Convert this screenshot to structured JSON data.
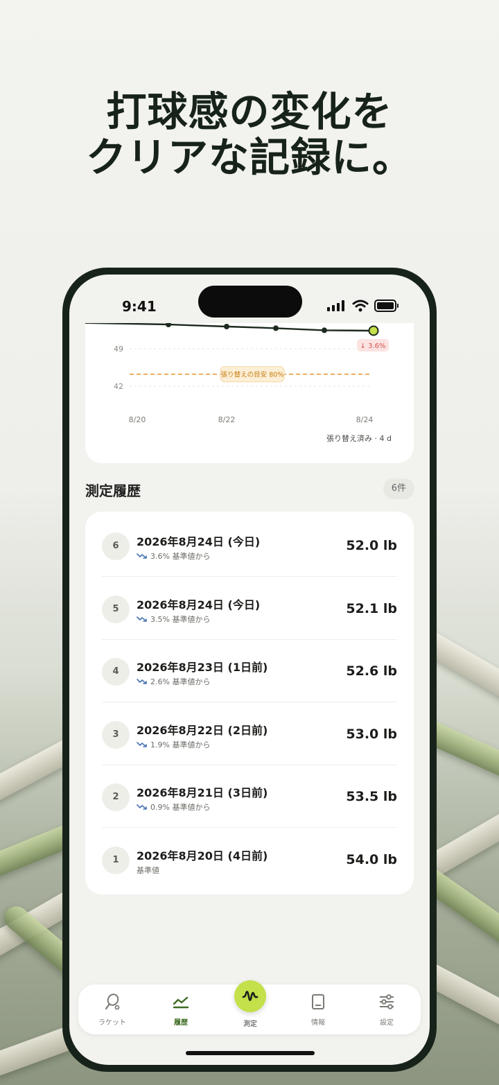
{
  "headline": {
    "line1": "打球感の変化を",
    "line2": "クリアな記録に。"
  },
  "status_bar": {
    "time": "9:41"
  },
  "chart_data": {
    "type": "line",
    "x": [
      "8/20",
      "8/21",
      "8/22",
      "8/23",
      "8/24",
      "8/24"
    ],
    "x_tick_labels": [
      "8/20",
      "8/22",
      "8/24"
    ],
    "y_tick_labels": [
      "49",
      "42"
    ],
    "series": [
      {
        "values": [
          54.0,
          53.5,
          53.0,
          52.6,
          52.1,
          52.0
        ]
      }
    ],
    "threshold": {
      "value": 43.2,
      "label": "張り替えの目安 80%"
    },
    "change_badge": "↓ 3.6%",
    "note": "張り替え済み · 4 d",
    "colors": {
      "line": "#1c2a1e",
      "threshold": "#e0962e",
      "current_point": "#c4e04a",
      "badge_text": "#d9534f"
    }
  },
  "history": {
    "title": "測定履歴",
    "count": "6件",
    "rows": [
      {
        "num": "6",
        "date": "2026年8月24日 (今日)",
        "sub": "3.6% 基準値から",
        "trend": true,
        "value": "52.0 lb"
      },
      {
        "num": "5",
        "date": "2026年8月24日 (今日)",
        "sub": "3.5% 基準値から",
        "trend": true,
        "value": "52.1 lb"
      },
      {
        "num": "4",
        "date": "2026年8月23日 (1日前)",
        "sub": "2.6% 基準値から",
        "trend": true,
        "value": "52.6 lb"
      },
      {
        "num": "3",
        "date": "2026年8月22日 (2日前)",
        "sub": "1.9% 基準値から",
        "trend": true,
        "value": "53.0 lb"
      },
      {
        "num": "2",
        "date": "2026年8月21日 (3日前)",
        "sub": "0.9% 基準値から",
        "trend": true,
        "value": "53.5 lb"
      },
      {
        "num": "1",
        "date": "2026年8月20日 (4日前)",
        "sub": "基準値",
        "trend": false,
        "value": "54.0 lb"
      }
    ]
  },
  "tabbar": {
    "racket": "ラケット",
    "history": "履歴",
    "measure": "測定",
    "info": "情報",
    "settings": "設定",
    "active": "history",
    "accent": "#3f6b22"
  }
}
